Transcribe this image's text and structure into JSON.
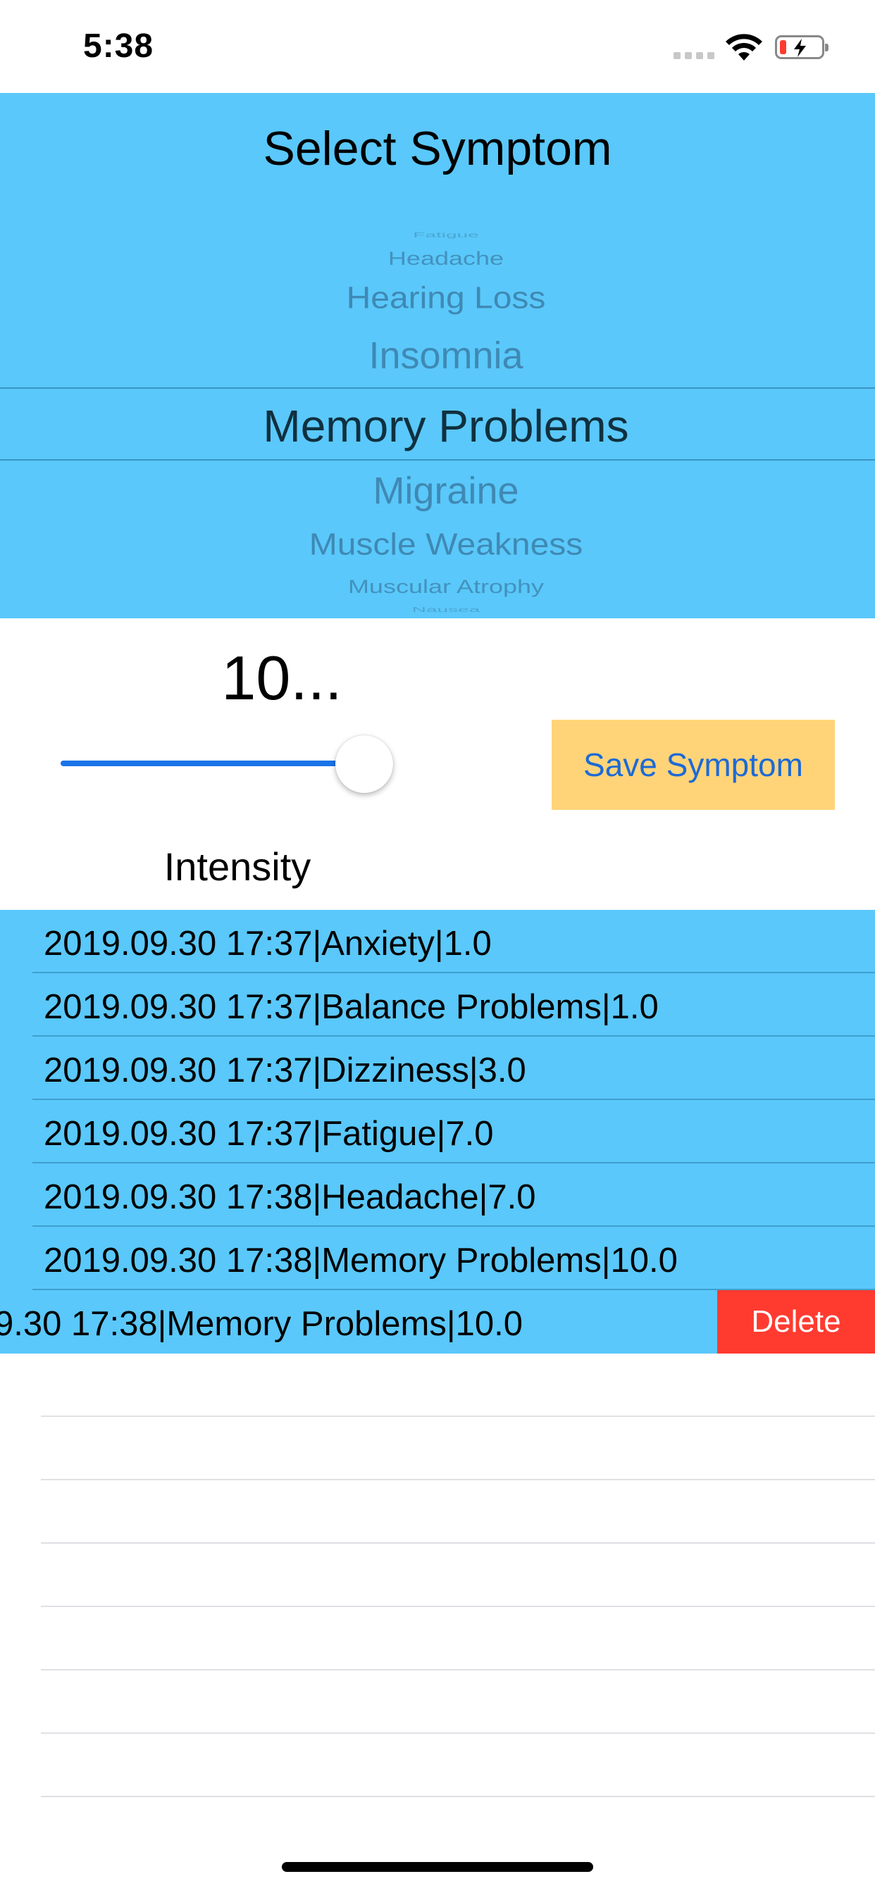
{
  "status_bar": {
    "time": "5:38"
  },
  "picker": {
    "title": "Select Symptom",
    "items_above": [
      "Fatigue",
      "Headache",
      "Hearing Loss",
      "Insomnia"
    ],
    "selected": "Memory Problems",
    "items_below": [
      "Migraine",
      "Muscle Weakness",
      "Muscular Atrophy",
      "Nausea"
    ]
  },
  "intensity": {
    "value_text": "10...",
    "label": "Intensity",
    "slider_value": 10,
    "slider_max": 10
  },
  "save_button": {
    "label": "Save Symptom"
  },
  "log": {
    "rows": [
      "2019.09.30 17:37|Anxiety|1.0",
      "2019.09.30 17:37|Balance Problems|1.0",
      "2019.09.30 17:37|Dizziness|3.0",
      "2019.09.30 17:37|Fatigue|7.0",
      "2019.09.30 17:38|Headache|7.0",
      "2019.09.30 17:38|Memory Problems|10.0"
    ],
    "swiped_row": "9.30 17:38|Memory Problems|10.0",
    "delete_label": "Delete"
  },
  "colors": {
    "picker_bg": "#5ac8fa",
    "button_bg": "#ffd479",
    "button_text": "#1c6ad6",
    "delete_bg": "#ff3b30",
    "slider_fill": "#1a73e8"
  }
}
